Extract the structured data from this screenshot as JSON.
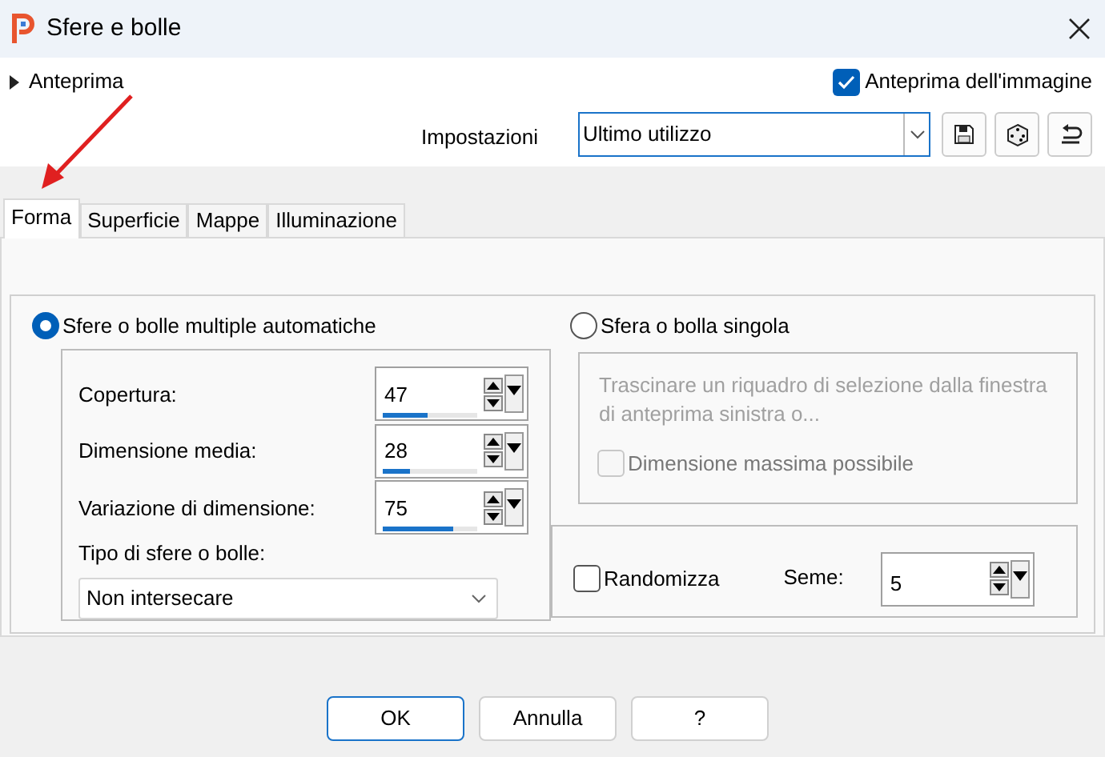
{
  "window": {
    "title": "Sfere e bolle"
  },
  "preview_toggle": {
    "label": "Anteprima",
    "expanded": false
  },
  "image_preview": {
    "label": "Anteprima dell'immagine",
    "checked": true
  },
  "settings": {
    "label": "Impostazioni",
    "value": "Ultimo utilizzo"
  },
  "tabs": [
    {
      "label": "Forma",
      "selected": true
    },
    {
      "label": "Superficie",
      "selected": false
    },
    {
      "label": "Mappe",
      "selected": false
    },
    {
      "label": "Illuminazione",
      "selected": false
    }
  ],
  "mode_multiple": {
    "label": "Sfere o bolle multiple automatiche",
    "selected": true
  },
  "fields": [
    {
      "label": "Copertura:",
      "value": "47",
      "level": 0.47
    },
    {
      "label": "Dimensione media:",
      "value": "28",
      "level": 0.28
    },
    {
      "label": "Variazione di dimensione:",
      "value": "75",
      "level": 0.75
    }
  ],
  "type": {
    "label": "Tipo di sfere o bolle:",
    "value": "Non intersecare"
  },
  "mode_single": {
    "label": "Sfera o bolla singola",
    "selected": false
  },
  "single_hint": "Trascinare un riquadro di selezione dalla finestra di anteprima sinistra o...",
  "max_size": {
    "label": "Dimensione massima possibile",
    "checked": false,
    "disabled": true
  },
  "randomize": {
    "label": "Randomizza",
    "checked": false
  },
  "seed": {
    "label": "Seme:",
    "value": "5"
  },
  "buttons": [
    "OK",
    "Annulla",
    "?"
  ]
}
